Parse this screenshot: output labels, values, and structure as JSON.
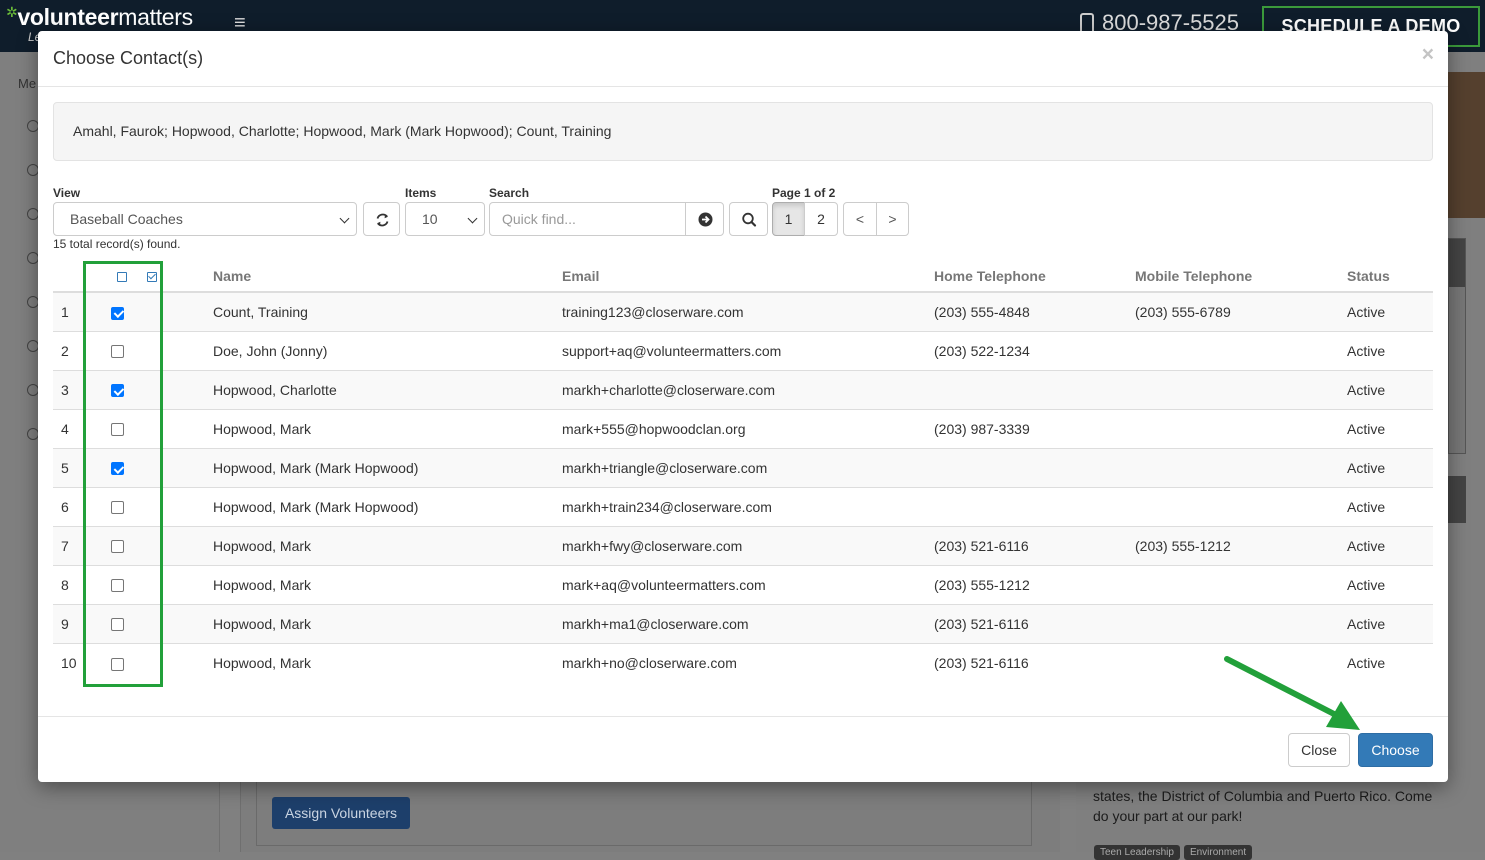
{
  "background": {
    "logo_bold": "volunteer",
    "logo_light": "matters",
    "logo_tagline": "Le",
    "phone": "800-987-5525",
    "demo_button": "SCHEDULE A DEMO",
    "sidebar_label": "Me",
    "assign_button": "Assign Volunteers",
    "promo_text": "states, the District of Columbia and Puerto Rico. Come do your part at our park!",
    "chips": [
      "Teen Leadership",
      "Environment"
    ]
  },
  "modal": {
    "title": "Choose Contact(s)",
    "close_x": "×",
    "selected_summary": "Amahl, Faurok; Hopwood, Charlotte; Hopwood, Mark (Mark Hopwood); Count, Training",
    "view_label": "View",
    "view_value": "Baseball Coaches",
    "items_label": "Items",
    "items_value": "10",
    "search_label": "Search",
    "search_placeholder": "Quick find...",
    "page_info": "Page 1 of 2",
    "pages": [
      "1",
      "2"
    ],
    "prev_label": "<",
    "next_label": ">",
    "total_records": "15 total record(s) found.",
    "columns": {
      "name": "Name",
      "email": "Email",
      "home": "Home Telephone",
      "mobile": "Mobile Telephone",
      "status": "Status"
    },
    "rows": [
      {
        "num": "1",
        "checked": true,
        "name": "Count, Training",
        "email": "training123@closerware.com",
        "home": "(203) 555-4848",
        "mobile": "(203) 555-6789",
        "status": "Active"
      },
      {
        "num": "2",
        "checked": false,
        "name": "Doe, John (Jonny)",
        "email": "support+aq@volunteermatters.com",
        "home": "(203) 522-1234",
        "mobile": "",
        "status": "Active"
      },
      {
        "num": "3",
        "checked": true,
        "name": "Hopwood, Charlotte",
        "email": "markh+charlotte@closerware.com",
        "home": "",
        "mobile": "",
        "status": "Active"
      },
      {
        "num": "4",
        "checked": false,
        "name": "Hopwood, Mark",
        "email": "mark+555@hopwoodclan.org",
        "home": "(203) 987-3339",
        "mobile": "",
        "status": "Active"
      },
      {
        "num": "5",
        "checked": true,
        "name": "Hopwood, Mark (Mark Hopwood)",
        "email": "markh+triangle@closerware.com",
        "home": "",
        "mobile": "",
        "status": "Active"
      },
      {
        "num": "6",
        "checked": false,
        "name": "Hopwood, Mark (Mark Hopwood)",
        "email": "markh+train234@closerware.com",
        "home": "",
        "mobile": "",
        "status": "Active"
      },
      {
        "num": "7",
        "checked": false,
        "name": "Hopwood, Mark",
        "email": "markh+fwy@closerware.com",
        "home": "(203) 521-6116",
        "mobile": "(203) 555-1212",
        "status": "Active"
      },
      {
        "num": "8",
        "checked": false,
        "name": "Hopwood, Mark",
        "email": "mark+aq@volunteermatters.com",
        "home": "(203) 555-1212",
        "mobile": "",
        "status": "Active"
      },
      {
        "num": "9",
        "checked": false,
        "name": "Hopwood, Mark",
        "email": "markh+ma1@closerware.com",
        "home": "(203) 521-6116",
        "mobile": "",
        "status": "Active"
      },
      {
        "num": "10",
        "checked": false,
        "name": "Hopwood, Mark",
        "email": "markh+no@closerware.com",
        "home": "(203) 521-6116",
        "mobile": "",
        "status": "Active"
      }
    ],
    "close_button": "Close",
    "choose_button": "Choose"
  },
  "colors": {
    "primary": "#337ab7",
    "annotation_green": "#22a03a",
    "checkbox_blue": "#0075ff"
  },
  "icons": [
    "refresh-icon",
    "arrow-right-circle-icon",
    "search-icon",
    "phone-icon",
    "hamburger-icon"
  ]
}
